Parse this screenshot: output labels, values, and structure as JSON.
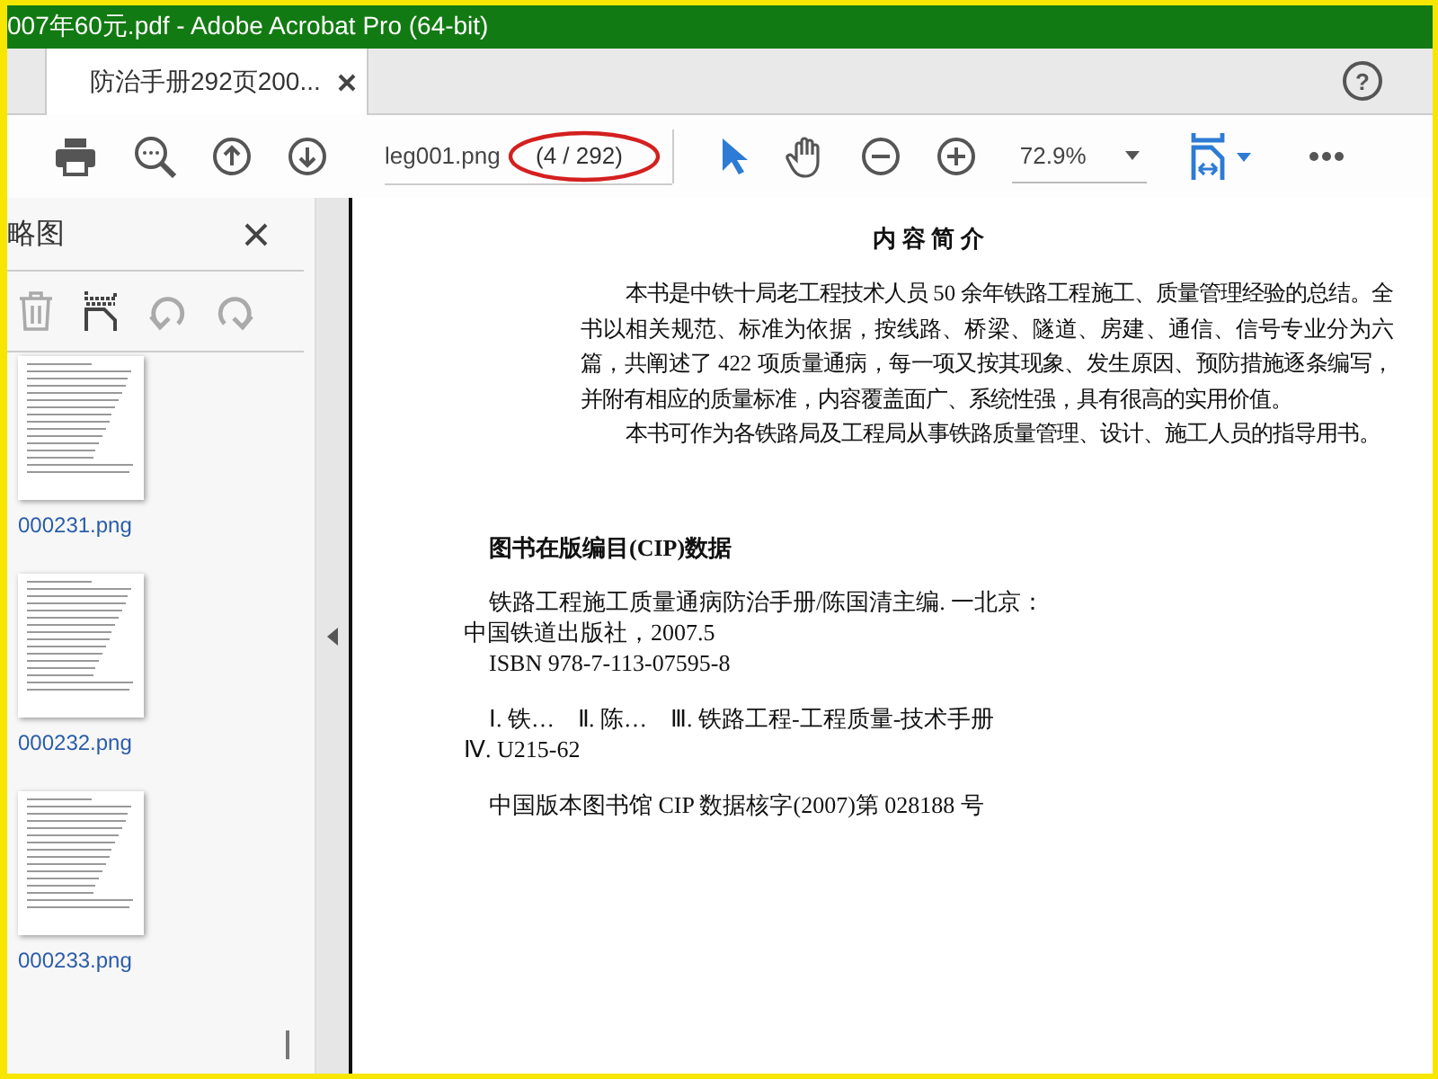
{
  "window": {
    "title": "007年60元.pdf - Adobe Acrobat Pro (64-bit)"
  },
  "tabs": [
    {
      "label": "防治手册292页200...",
      "selected": true
    }
  ],
  "help_button": {
    "label": "?"
  },
  "toolbar": {
    "file_field": {
      "value": "leg001.png"
    },
    "page_indicator": "(4 / 292)",
    "zoom_field": {
      "value": "72.9%"
    }
  },
  "sidebar": {
    "title": "略图",
    "thumbnails": [
      {
        "label": "000231.png"
      },
      {
        "label": "000232.png"
      },
      {
        "label": "000233.png"
      }
    ]
  },
  "document": {
    "heading": "内 容 简 介",
    "paragraphs": [
      "本书是中铁十局老工程技术人员 50 余年铁路工程施工、质量管理经验的总结。全书以相关规范、标准为依据，按线路、桥梁、隧道、房建、通信、信号专业分为六篇，共阐述了 422 项质量通病，每一项又按其现象、发生原因、预防措施逐条编写，并附有相应的质量标准，内容覆盖面广、系统性强，具有很高的实用价值。",
      "本书可作为各铁路局及工程局从事铁路质量管理、设计、施工人员的指导用书。"
    ],
    "cip_heading": "图书在版编目(CIP)数据",
    "cip_groups": [
      [
        {
          "text": "铁路工程施工质量通病防治手册/陈国清主编. 一北京：",
          "indent": true
        },
        {
          "text": "中国铁道出版社，2007.5",
          "indent": false
        },
        {
          "text": "ISBN 978-7-113-07595-8",
          "indent": true
        }
      ],
      [
        {
          "text": "Ⅰ. 铁…　Ⅱ. 陈…　Ⅲ. 铁路工程-工程质量-技术手册",
          "indent": true
        },
        {
          "text": "Ⅳ. U215-62",
          "indent": false
        }
      ],
      [
        {
          "text": "中国版本图书馆 CIP 数据核字(2007)第 028188 号",
          "indent": true
        }
      ]
    ]
  }
}
